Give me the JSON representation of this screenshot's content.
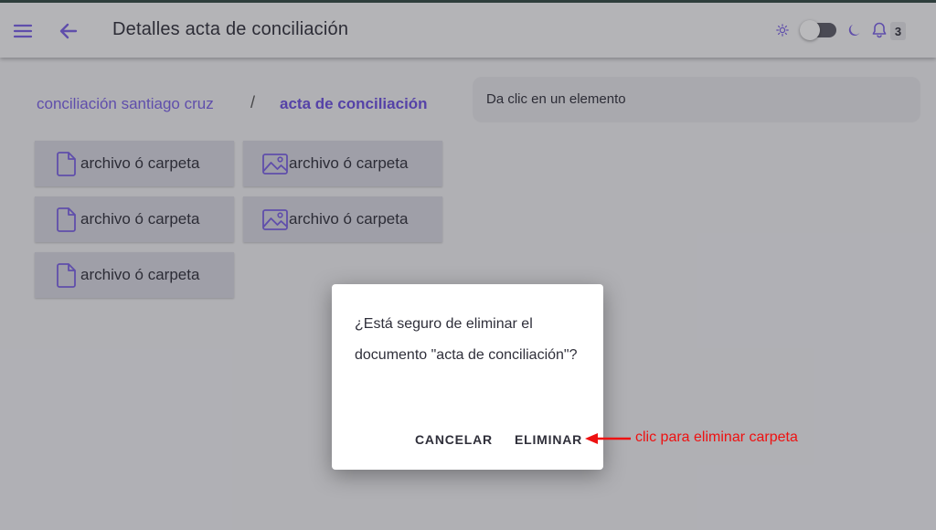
{
  "app": {
    "title": "Detalles acta de conciliación",
    "notifications_count": "3"
  },
  "breadcrumb": {
    "parent": "conciliación santiago cruz",
    "separator": "/",
    "current": "acta de conciliación"
  },
  "info_panel": {
    "text": "Da clic en un elemento"
  },
  "files": [
    {
      "label": "archivo ó carpeta",
      "icon": "document-icon"
    },
    {
      "label": "archivo ó carpeta",
      "icon": "image-icon"
    },
    {
      "label": "archivo ó carpeta",
      "icon": "document-icon"
    },
    {
      "label": "archivo ó carpeta",
      "icon": "image-icon"
    },
    {
      "label": "archivo ó carpeta",
      "icon": "document-icon"
    }
  ],
  "dialog": {
    "message": "¿Está seguro de eliminar el documento \"acta de conciliación\"?",
    "cancel_label": "CANCELAR",
    "delete_label": "ELIMINAR"
  },
  "annotation": {
    "text": "clic para eliminar carpeta"
  },
  "colors": {
    "accent": "#7a60e6",
    "annotation": "#ee1111"
  }
}
